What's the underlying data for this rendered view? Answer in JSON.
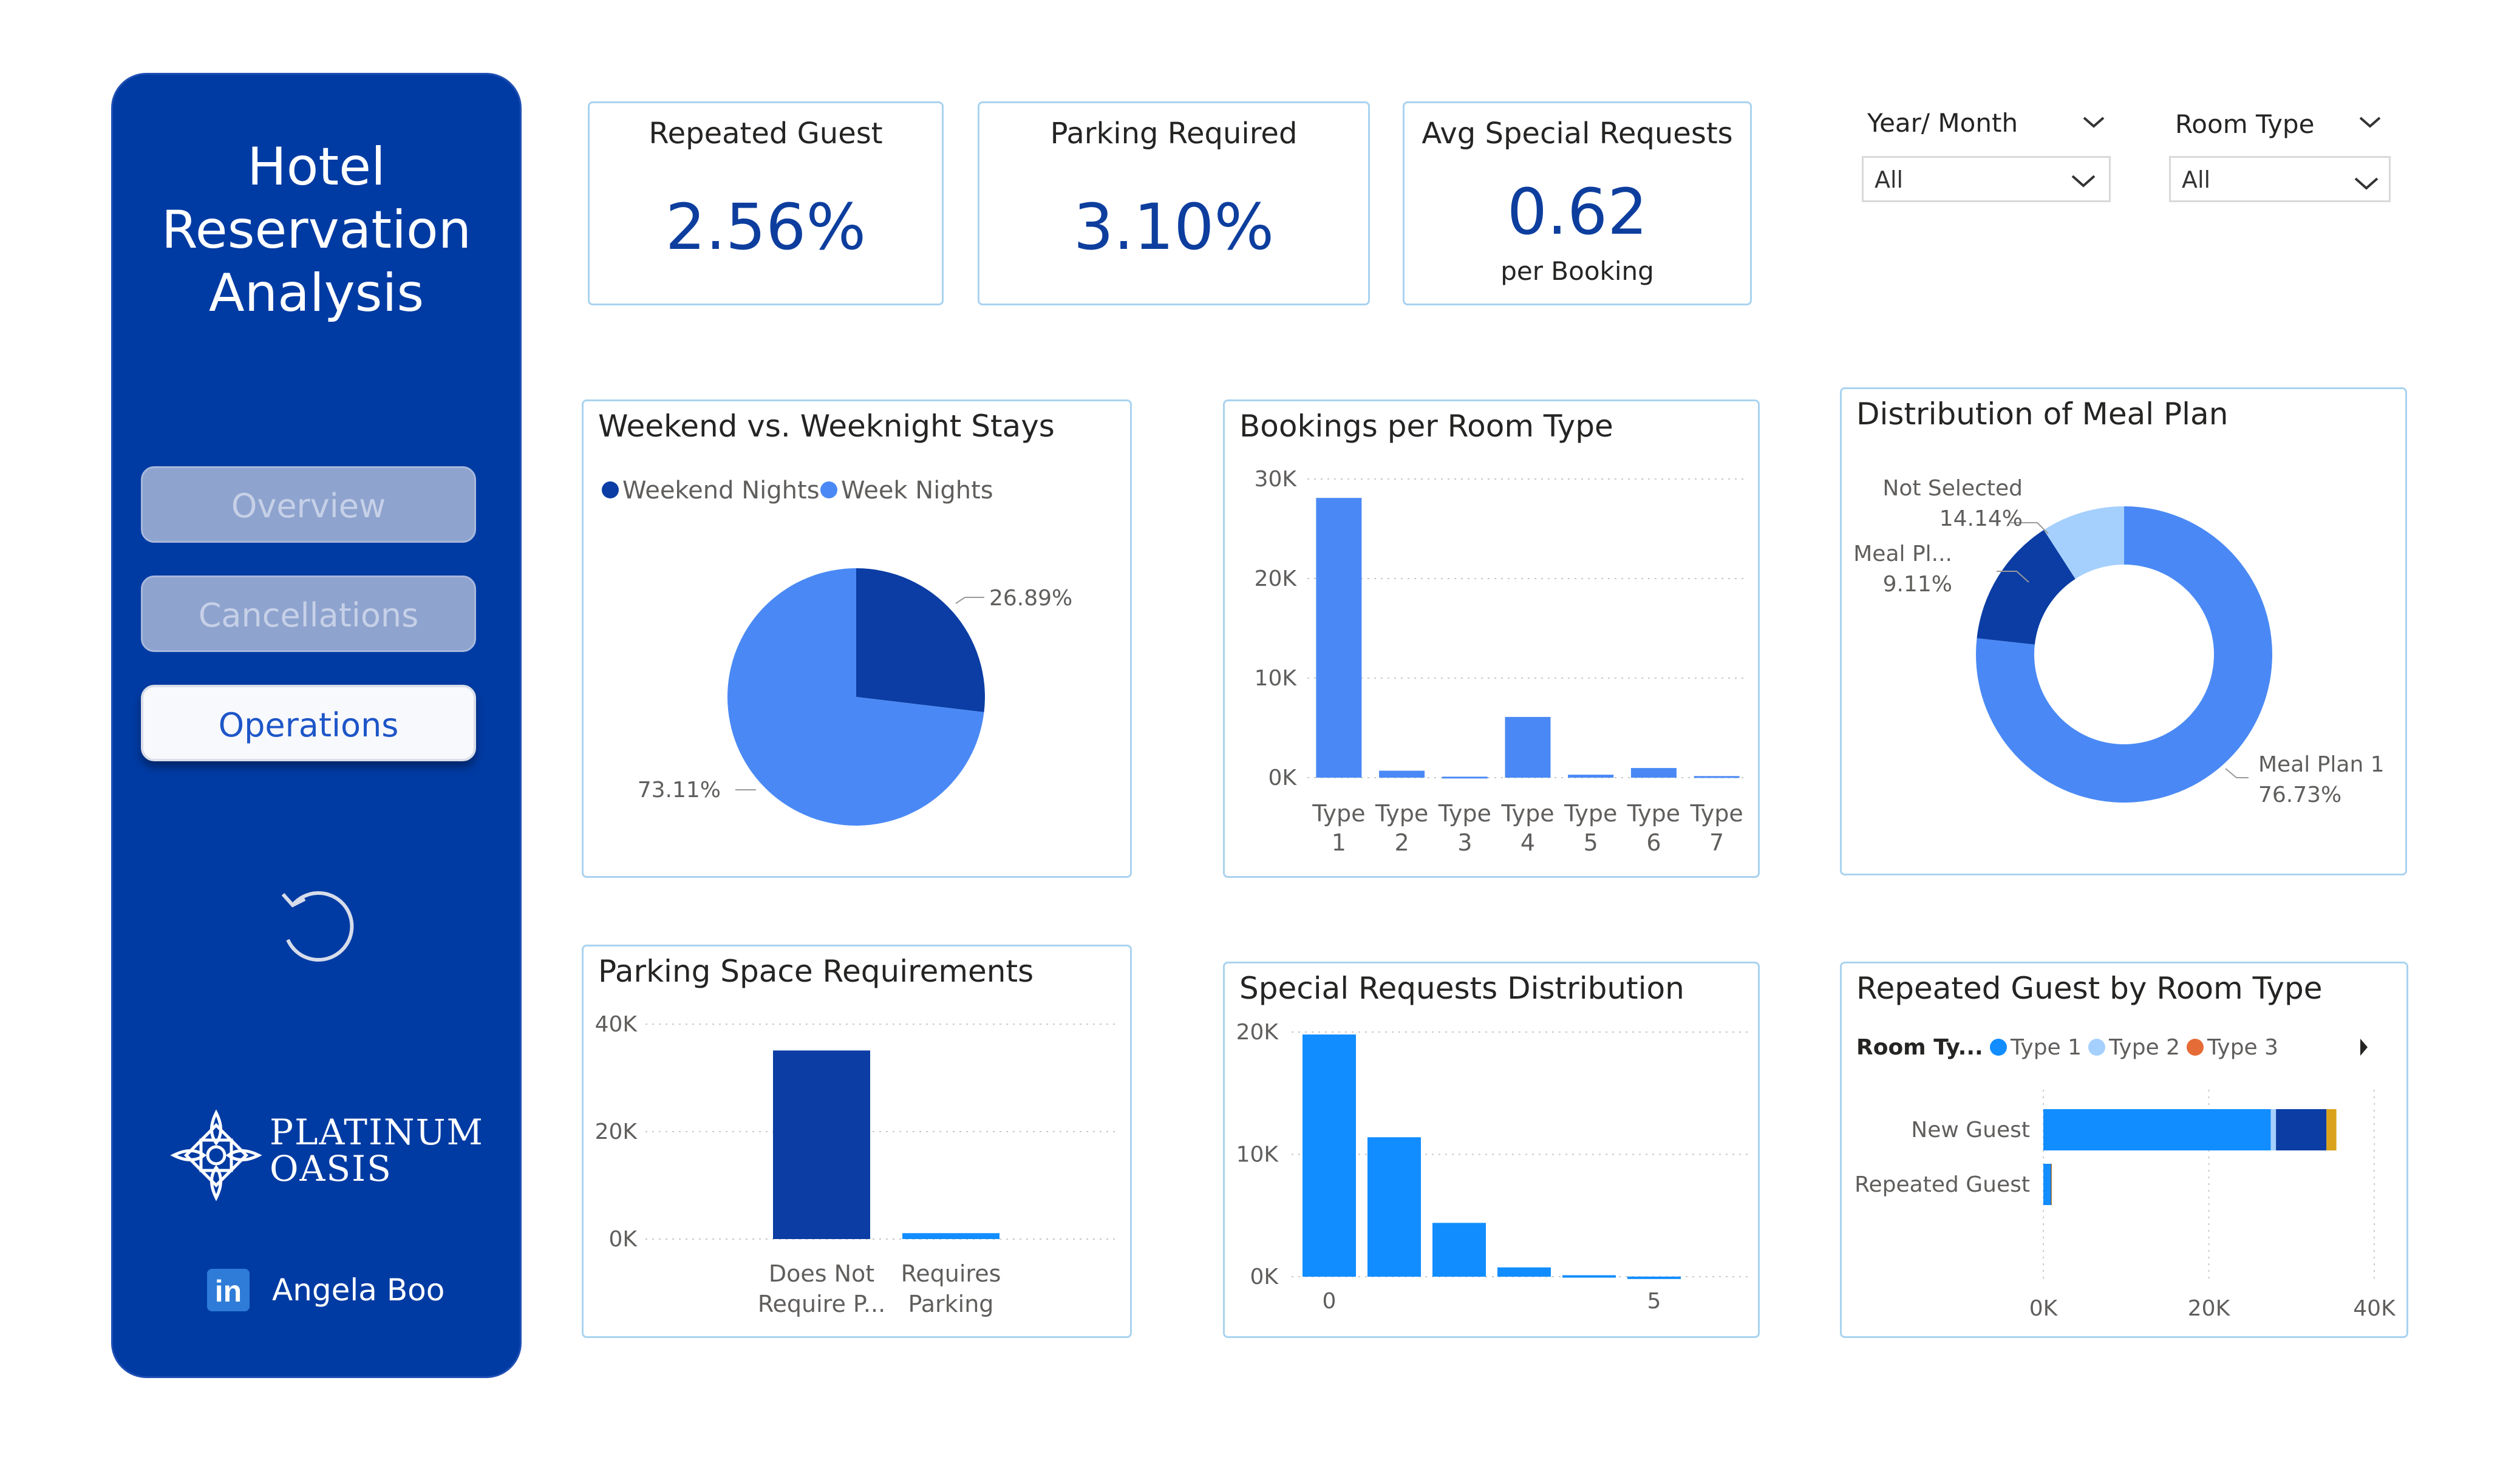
{
  "sidebar": {
    "title": "Hotel\nReservation\nAnalysis",
    "nav": [
      {
        "label": "Overview",
        "state": "inactive"
      },
      {
        "label": "Cancellations",
        "state": "inactive"
      },
      {
        "label": "Operations",
        "state": "active"
      }
    ],
    "reset_icon": "reset-arrow-icon",
    "brand": "PLATINUM\nOASIS",
    "brand_icon": "ornament-logo-icon",
    "social_icon": "linkedin-icon",
    "social_glyph": "in",
    "author": "Angela Boo"
  },
  "kpis": {
    "repeated_guest": {
      "title": "Repeated Guest",
      "value": "2.56%"
    },
    "parking_required": {
      "title": "Parking Required",
      "value": "3.10%"
    },
    "avg_special_requests": {
      "title": "Avg Special Requests",
      "value": "0.62",
      "sub": "per Booking"
    }
  },
  "slicers": {
    "year_month": {
      "label": "Year/ Month",
      "value": "All"
    },
    "room_type": {
      "label": "Room Type",
      "value": "All"
    }
  },
  "colors": {
    "sidebar": "#003BA3",
    "dark_blue": "#0B3DA4",
    "mid_blue": "#4A89F5",
    "light_blue": "#A5D0FD",
    "bar_blue": "#118DFF",
    "orange": "#E66C37",
    "gold": "#D9A21B",
    "card_border": "#A9D3F0"
  },
  "chart_data": [
    {
      "id": "weekend_weeknight",
      "type": "pie",
      "title": "Weekend vs. Weeknight Stays",
      "legend": [
        "Weekend Nights",
        "Week Nights"
      ],
      "labels": [
        "Weekend Nights",
        "Week Nights"
      ],
      "values": [
        26.89,
        73.11
      ],
      "data_labels": [
        "26.89%",
        "73.11%"
      ]
    },
    {
      "id": "bookings_room_type",
      "type": "bar",
      "title": "Bookings per Room Type",
      "categories": [
        "Type 1",
        "Type 2",
        "Type 3",
        "Type 4",
        "Type 5",
        "Type 6",
        "Type 7"
      ],
      "values": [
        28100,
        700,
        100,
        6100,
        300,
        970,
        160
      ],
      "ylim": [
        0,
        30000
      ],
      "yticks": [
        "30K",
        "20K",
        "10K",
        "0K"
      ],
      "grid": true
    },
    {
      "id": "meal_plan",
      "type": "pie",
      "title": "Distribution of Meal Plan",
      "labels": [
        "Meal Plan 1",
        "Not Selected",
        "Meal Pl..."
      ],
      "values": [
        76.73,
        14.14,
        9.11
      ],
      "data_labels": [
        "76.73%",
        "14.14%",
        "9.11%"
      ]
    },
    {
      "id": "parking_space",
      "type": "bar",
      "title": "Parking Space Requirements",
      "categories": [
        "Does Not\nRequire P...",
        "Requires\nParking"
      ],
      "values": [
        35100,
        1100
      ],
      "ylim": [
        0,
        40000
      ],
      "yticks": [
        "40K",
        "20K",
        "0K"
      ],
      "grid": true
    },
    {
      "id": "special_requests",
      "type": "bar",
      "title": "Special Requests Distribution",
      "x": [
        0,
        1,
        2,
        3,
        4,
        5
      ],
      "values": [
        19800,
        11400,
        4400,
        760,
        120,
        10
      ],
      "ylim": [
        0,
        20000
      ],
      "yticks": [
        "20K",
        "10K",
        "0K"
      ],
      "xticks": [
        "0",
        "5"
      ],
      "grid": true
    },
    {
      "id": "repeated_guest_room_type",
      "type": "bar",
      "title": "Repeated Guest by Room Type",
      "orientation": "horizontal",
      "legend_title": "Room Ty...",
      "legend": [
        "Type 1",
        "Type 2",
        "Type 3"
      ],
      "categories": [
        "New Guest",
        "Repeated Guest"
      ],
      "series": [
        {
          "name": "Type 1",
          "values": [
            27500,
            870
          ]
        },
        {
          "name": "Type 2",
          "values": [
            620,
            10
          ]
        },
        {
          "name": "Type 3",
          "values": [
            6100,
            80
          ]
        },
        {
          "values": [
            1200,
            20
          ]
        }
      ],
      "xlim": [
        0,
        40000
      ],
      "xticks": [
        "0K",
        "20K",
        "40K"
      ],
      "grid": true
    }
  ]
}
